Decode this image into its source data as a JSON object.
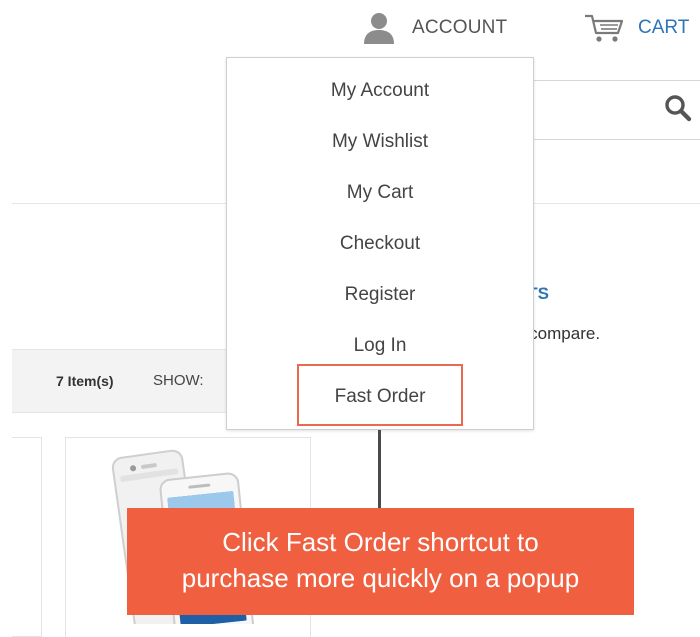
{
  "header": {
    "account_label": "ACCOUNT",
    "account_icon": "user-icon",
    "cart_label": "CART",
    "cart_icon": "shopping-cart-icon"
  },
  "search": {
    "icon": "search-icon"
  },
  "account_menu": {
    "items": [
      {
        "label": "My Account"
      },
      {
        "label": "My Wishlist"
      },
      {
        "label": "My Cart"
      },
      {
        "label": "Checkout"
      },
      {
        "label": "Register"
      },
      {
        "label": "Log In"
      },
      {
        "label": "Fast Order",
        "highlighted": true
      }
    ],
    "highlight_color": "#e96a4f"
  },
  "compare": {
    "title_fragment": "CTS",
    "text_fragment": "o compare."
  },
  "toolbar": {
    "item_count": "7 Item(s)",
    "show_label": "SHOW:"
  },
  "callout": {
    "line1": "Click Fast Order shortcut to",
    "line2": "purchase more quickly on a popup",
    "background_color": "#f05f40"
  },
  "colors": {
    "link_blue": "#2f74b5",
    "text_gray": "#444444"
  }
}
